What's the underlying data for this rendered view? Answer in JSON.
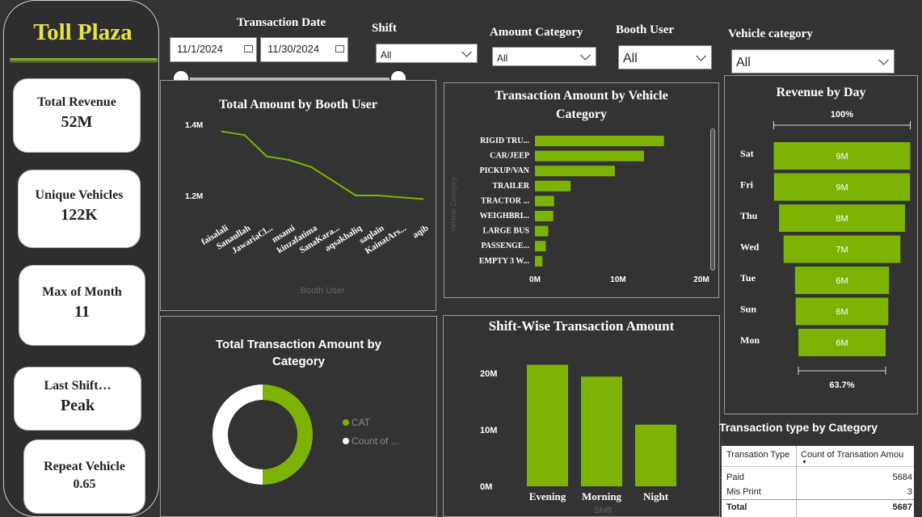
{
  "app": {
    "title": "Toll Plaza"
  },
  "kpis": [
    {
      "label": "Total Revenue",
      "value": "52M"
    },
    {
      "label": "Unique Vehicles",
      "value": "122K"
    },
    {
      "label": "Max of Month",
      "value": "11"
    },
    {
      "label": "Last Shift…",
      "value": "Peak"
    },
    {
      "label": "Repeat Vehicle",
      "value": "0.65"
    }
  ],
  "filters": {
    "transaction_date": {
      "label": "Transaction Date",
      "start": "11/1/2024",
      "end": "11/30/2024"
    },
    "shift": {
      "label": "Shift",
      "value": "All"
    },
    "amount_category": {
      "label": "Amount Category",
      "value": "All"
    },
    "booth_user": {
      "label": "Booth User",
      "value": "All"
    },
    "vehicle_category": {
      "label": "Vehicle category",
      "value": "All"
    }
  },
  "colors": {
    "accent": "#7cb305",
    "background": "#333333",
    "title_yellow": "#e8e24a"
  },
  "chart_data": [
    {
      "id": "booth_user",
      "type": "line",
      "title": "Total Amount by Booth User",
      "xlabel": "Booth User",
      "ylabel": "",
      "y_ticks": [
        "1.4M",
        "1.2M"
      ],
      "ylim": [
        1.1,
        1.45
      ],
      "categories": [
        "faisalali",
        "Sanaullah",
        "JawariaCl...",
        "msami",
        "kinzafatima",
        "SanaKara...",
        "aqsakhaliq",
        "saqlain",
        "KainatArs...",
        "aqib"
      ],
      "values": [
        1.38,
        1.37,
        1.31,
        1.3,
        1.28,
        1.24,
        1.2,
        1.2,
        1.195,
        1.19
      ]
    },
    {
      "id": "vehicle_category",
      "type": "bar",
      "orientation": "horizontal",
      "title": "Transaction Amount by Vehicle Category",
      "ylabel": "Vehicle Category",
      "x_ticks": [
        "0M",
        "10M",
        "20M"
      ],
      "xlim": [
        0,
        20
      ],
      "categories": [
        "RIGID TRU...",
        "CAR/JEEP",
        "PICKUP/VAN",
        "TRAILER",
        "TRACTOR ...",
        "WEIGHBRI...",
        "LARGE BUS",
        "PASSENGE...",
        "EMPTY 3 W..."
      ],
      "values": [
        15.5,
        13.1,
        9.6,
        4.3,
        2.3,
        2.2,
        1.6,
        1.3,
        0.9
      ]
    },
    {
      "id": "revenue_by_day",
      "type": "bar",
      "subtype": "funnel",
      "title": "Revenue by Day",
      "top_label": "100%",
      "bottom_label": "63.7%",
      "categories": [
        "Sat",
        "Fri",
        "Thu",
        "Wed",
        "Tue",
        "Sun",
        "Mon"
      ],
      "values": [
        9.0,
        8.96,
        8.3,
        7.7,
        6.2,
        6.1,
        5.75
      ],
      "value_labels": [
        "9M",
        "9M",
        "8M",
        "7M",
        "6M",
        "6M",
        "6M"
      ]
    },
    {
      "id": "category_donut",
      "type": "pie",
      "subtype": "donut",
      "title": "Total Transaction Amount by Category",
      "legend": [
        "CAT",
        "Count of ..."
      ],
      "values": [
        50,
        50
      ],
      "legend_colors": [
        "#7cb305",
        "#ffffff"
      ]
    },
    {
      "id": "shift_wise",
      "type": "bar",
      "title": "Shift-Wise Transaction Amount",
      "xlabel": "Shift",
      "y_ticks": [
        "20M",
        "10M",
        "0M"
      ],
      "ylim": [
        0,
        22
      ],
      "categories": [
        "Evening",
        "Morning",
        "Night"
      ],
      "values": [
        21.5,
        19.4,
        10.9
      ]
    }
  ],
  "table": {
    "title": "Transaction type by Category",
    "headers": [
      "Transation Type",
      "Count of Transation Amou"
    ],
    "rows": [
      {
        "type": "Paid",
        "count": "5684"
      },
      {
        "type": "Mis Print",
        "count": "3"
      }
    ],
    "total": {
      "type": "Total",
      "count": "5687"
    }
  }
}
